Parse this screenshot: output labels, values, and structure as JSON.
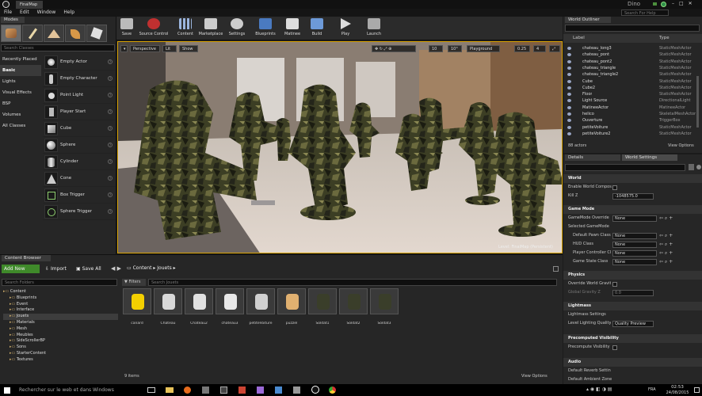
{
  "titlebar": {
    "tab": "FinalMap",
    "project": "Dino",
    "search_placeholder": "Search For Help"
  },
  "menu": [
    "File",
    "Edit",
    "Window",
    "Help"
  ],
  "modes": {
    "tab": "Modes",
    "search_placeholder": "Search Classes",
    "categories": [
      "Recently Placed",
      "Basic",
      "Lights",
      "Visual Effects",
      "BSP",
      "Volumes",
      "All Classes"
    ],
    "active_category": "Basic",
    "items": [
      "Empty Actor",
      "Empty Character",
      "Point Light",
      "Player Start",
      "Cube",
      "Sphere",
      "Cylinder",
      "Cone",
      "Box Trigger",
      "Sphere Trigger"
    ]
  },
  "toolbar": [
    "Save",
    "Source Control",
    "Content",
    "Marketplace",
    "Settings",
    "Blueprints",
    "Matinee",
    "Build",
    "Play",
    "Launch"
  ],
  "viewport": {
    "perspective": "Perspective",
    "lit": "Lit",
    "show": "Show",
    "snap": "10",
    "rot": "10°",
    "scale": "0.25",
    "camera_speed": "4",
    "tag": "Playground",
    "level_text": "Level:  FinalMap (Persistent)"
  },
  "outliner": {
    "tab": "World Outliner",
    "col_label": "Label",
    "col_type": "Type",
    "rows": [
      {
        "label": "chateau_long3",
        "type": "StaticMeshActor"
      },
      {
        "label": "chateau_pont",
        "type": "StaticMeshActor"
      },
      {
        "label": "chateau_pont2",
        "type": "StaticMeshActor"
      },
      {
        "label": "chateau_triangle",
        "type": "StaticMeshActor"
      },
      {
        "label": "chateau_triangle2",
        "type": "StaticMeshActor"
      },
      {
        "label": "Cube",
        "type": "StaticMeshActor"
      },
      {
        "label": "Cube2",
        "type": "StaticMeshActor"
      },
      {
        "label": "Floor",
        "type": "StaticMeshActor"
      },
      {
        "label": "Light Source",
        "type": "DirectionalLight"
      },
      {
        "label": "MatineeActor",
        "type": "MatineeActor"
      },
      {
        "label": "helico",
        "type": "SkeletalMeshActor"
      },
      {
        "label": "Ouverture",
        "type": "TriggerBox"
      },
      {
        "label": "petiteVoiture",
        "type": "StaticMeshActor"
      },
      {
        "label": "petiteVoiture2",
        "type": "StaticMeshActor"
      }
    ],
    "count": "88 actors",
    "view_options": "View Options"
  },
  "details": {
    "tab1": "Details",
    "tab2": "World Settings",
    "world": "World",
    "enable_world_compos": "Enable World Compos",
    "kill_z_label": "Kill Z",
    "kill_z_value": "-1048575.0",
    "game_mode": "Game Mode",
    "gamemode_override": "GameMode Override",
    "selected_gamemode": "Selected GameMode",
    "default_pawn": "Default Pawn Class",
    "hud_class": "HUD Class",
    "player_controller": "Player Controller Cl",
    "game_state": "Game State Class",
    "none": "None",
    "physics": "Physics",
    "override_gravity": "Override World Gravit",
    "global_gravity": "Global Gravity Z",
    "gravity_value": "0.0",
    "lightmass": "Lightmass",
    "lightmass_settings": "Lightmass Settings",
    "level_lighting_quality": "Level Lighting Quality",
    "quality_value": "Quality Preview",
    "precomputed_vis": "Precomputed Visibility",
    "precompute_vis": "Precompute Visibility",
    "audio": "Audio",
    "default_reverb": "Default Reverb Settin",
    "default_ambient": "Default Ambient Zone"
  },
  "content_browser": {
    "tab": "Content Browser",
    "add_new": "Add New",
    "import": "Import",
    "save_all": "Save All",
    "path": [
      "Content",
      "Jouets"
    ],
    "folder_search": "Search Folders",
    "filters": "Filters",
    "asset_search": "Search Jouets",
    "folders": [
      "Content",
      "Blueprints",
      "Event",
      "Interface",
      "Jouets",
      "Materials",
      "Mesh",
      "Meubles",
      "SideScrollerBP",
      "Sons",
      "StarterContent",
      "Textures"
    ],
    "assets": [
      "canard",
      "Chateau",
      "Chateau2",
      "chateau3",
      "petiteVoiture",
      "puzzel",
      "Soldat1",
      "Soldat2",
      "Soldat3"
    ],
    "item_count": "9 items",
    "view_options": "View Options"
  },
  "taskbar": {
    "search": "Rechercher sur le web et dans Windows",
    "lang": "FRA",
    "time": "02:53",
    "date": "24/08/2015"
  },
  "colors": {
    "accent_blue": "#2e6ab8",
    "add_green": "#3f8a2a",
    "viewport_border": "#d6a000"
  }
}
